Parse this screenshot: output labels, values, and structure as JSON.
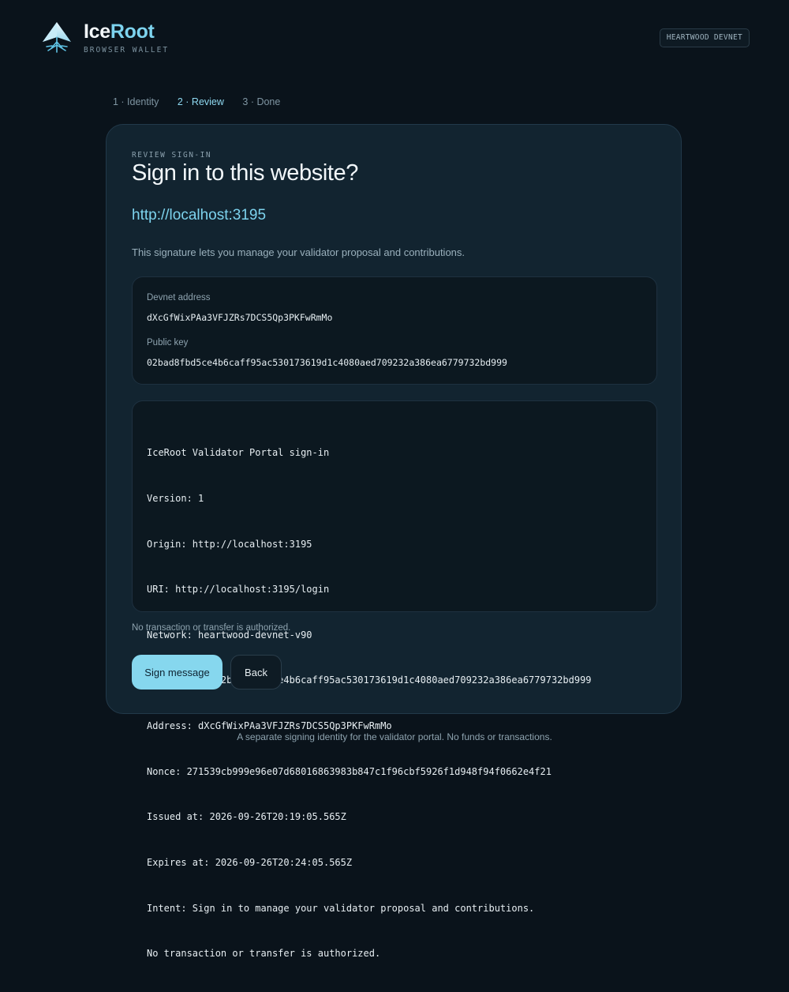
{
  "header": {
    "brand_part1": "Ice",
    "brand_part2": "Root",
    "subtitle": "BROWSER WALLET",
    "network_badge": "HEARTWOOD DEVNET"
  },
  "steps": [
    {
      "label": "1 · Identity",
      "active": false
    },
    {
      "label": "2 · Review",
      "active": true
    },
    {
      "label": "3 · Done",
      "active": false
    }
  ],
  "card": {
    "eyebrow": "REVIEW SIGN-IN",
    "title": "Sign in to this website?",
    "site_url": "http://localhost:3195",
    "description": "This signature lets you manage your validator proposal and contributions.",
    "identity": {
      "address_label": "Devnet address",
      "address_value": "dXcGfWixPAa3VFJZRs7DCS5Qp3PKFwRmMo",
      "pubkey_label": "Public key",
      "pubkey_value": "02bad8fbd5ce4b6caff95ac530173619d1c4080aed709232a386ea6779732bd999"
    },
    "message_lines": [
      "IceRoot Validator Portal sign-in",
      "Version: 1",
      "Origin: http://localhost:3195",
      "URI: http://localhost:3195/login",
      "Network: heartwood-devnet-v90",
      "Public key: 02bad8fbd5ce4b6caff95ac530173619d1c4080aed709232a386ea6779732bd999",
      "Address: dXcGfWixPAa3VFJZRs7DCS5Qp3PKFwRmMo",
      "Nonce: 271539cb999e96e07d68016863983b847c1f96cbf5926f1d948f94f0662e4f21",
      "Issued at: 2026-09-26T20:19:05.565Z",
      "Expires at: 2026-09-26T20:24:05.565Z",
      "Intent: Sign in to manage your validator proposal and contributions.",
      "No transaction or transfer is authorized."
    ],
    "note": "No transaction or transfer is authorized.",
    "sign_button": "Sign message",
    "back_button": "Back"
  },
  "footer": "A separate signing identity for the validator portal. No funds or transactions.",
  "colors": {
    "background": "#0a131b",
    "card": "#122430",
    "accent": "#7dd3ee",
    "primary_button": "#86d7ee"
  },
  "icons": {
    "logo": "iceroot-tree-logo-icon"
  }
}
